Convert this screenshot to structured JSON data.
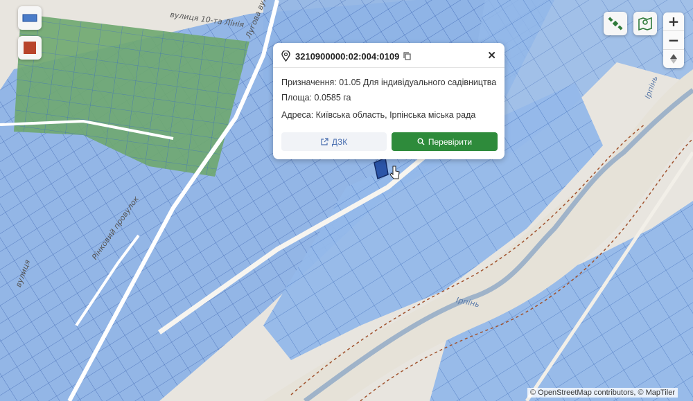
{
  "map": {
    "street_labels": [
      "вулиця 10-та Лінія",
      "Лугова вулиця",
      "Рінковий провулок",
      "вулиця"
    ],
    "river_labels": [
      "Ірпінь",
      "Ірпінь"
    ],
    "attribution": "© OpenStreetMap contributors, © MapTiler"
  },
  "popup": {
    "cadastral_number": "3210900000:02:004:0109",
    "purpose": "Призначення: 01.05 Для індивідуального садівництва",
    "area": "Площа: 0.0585 га",
    "address": "Адреса: Київська область, Ірпінська міська рада",
    "dzk_label": "ДЗК",
    "check_label": "Перевірити"
  },
  "controls": {
    "zoom_in": "+",
    "zoom_out": "−"
  },
  "colors": {
    "parcel_fill": "#7aa6e0",
    "popup_button": "#2e8b3b",
    "green_zone": "#5aa561"
  }
}
